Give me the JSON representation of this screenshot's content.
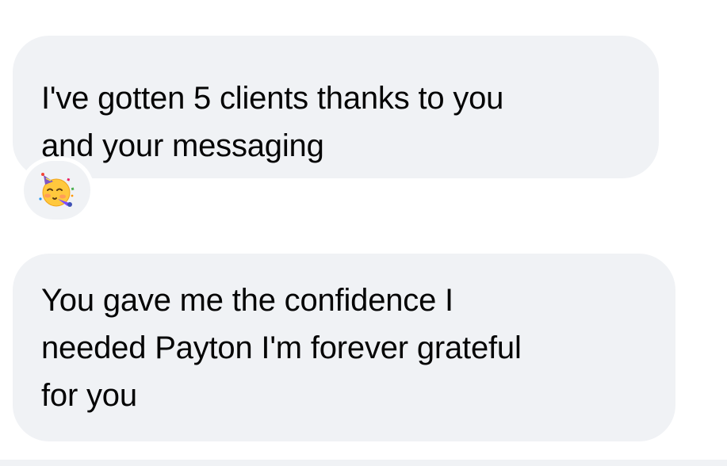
{
  "messages": [
    {
      "text": "I've gotten 5 clients thanks to you\nand your messaging",
      "reaction": {
        "icon": "partying-face-emoji",
        "count_visible": false
      }
    },
    {
      "text": "You gave me the confidence I\nneeded Payton I'm forever grateful\nfor you"
    }
  ],
  "colors": {
    "bubble_background": "#f0f2f5",
    "text": "#050505",
    "page_background": "#ffffff"
  }
}
